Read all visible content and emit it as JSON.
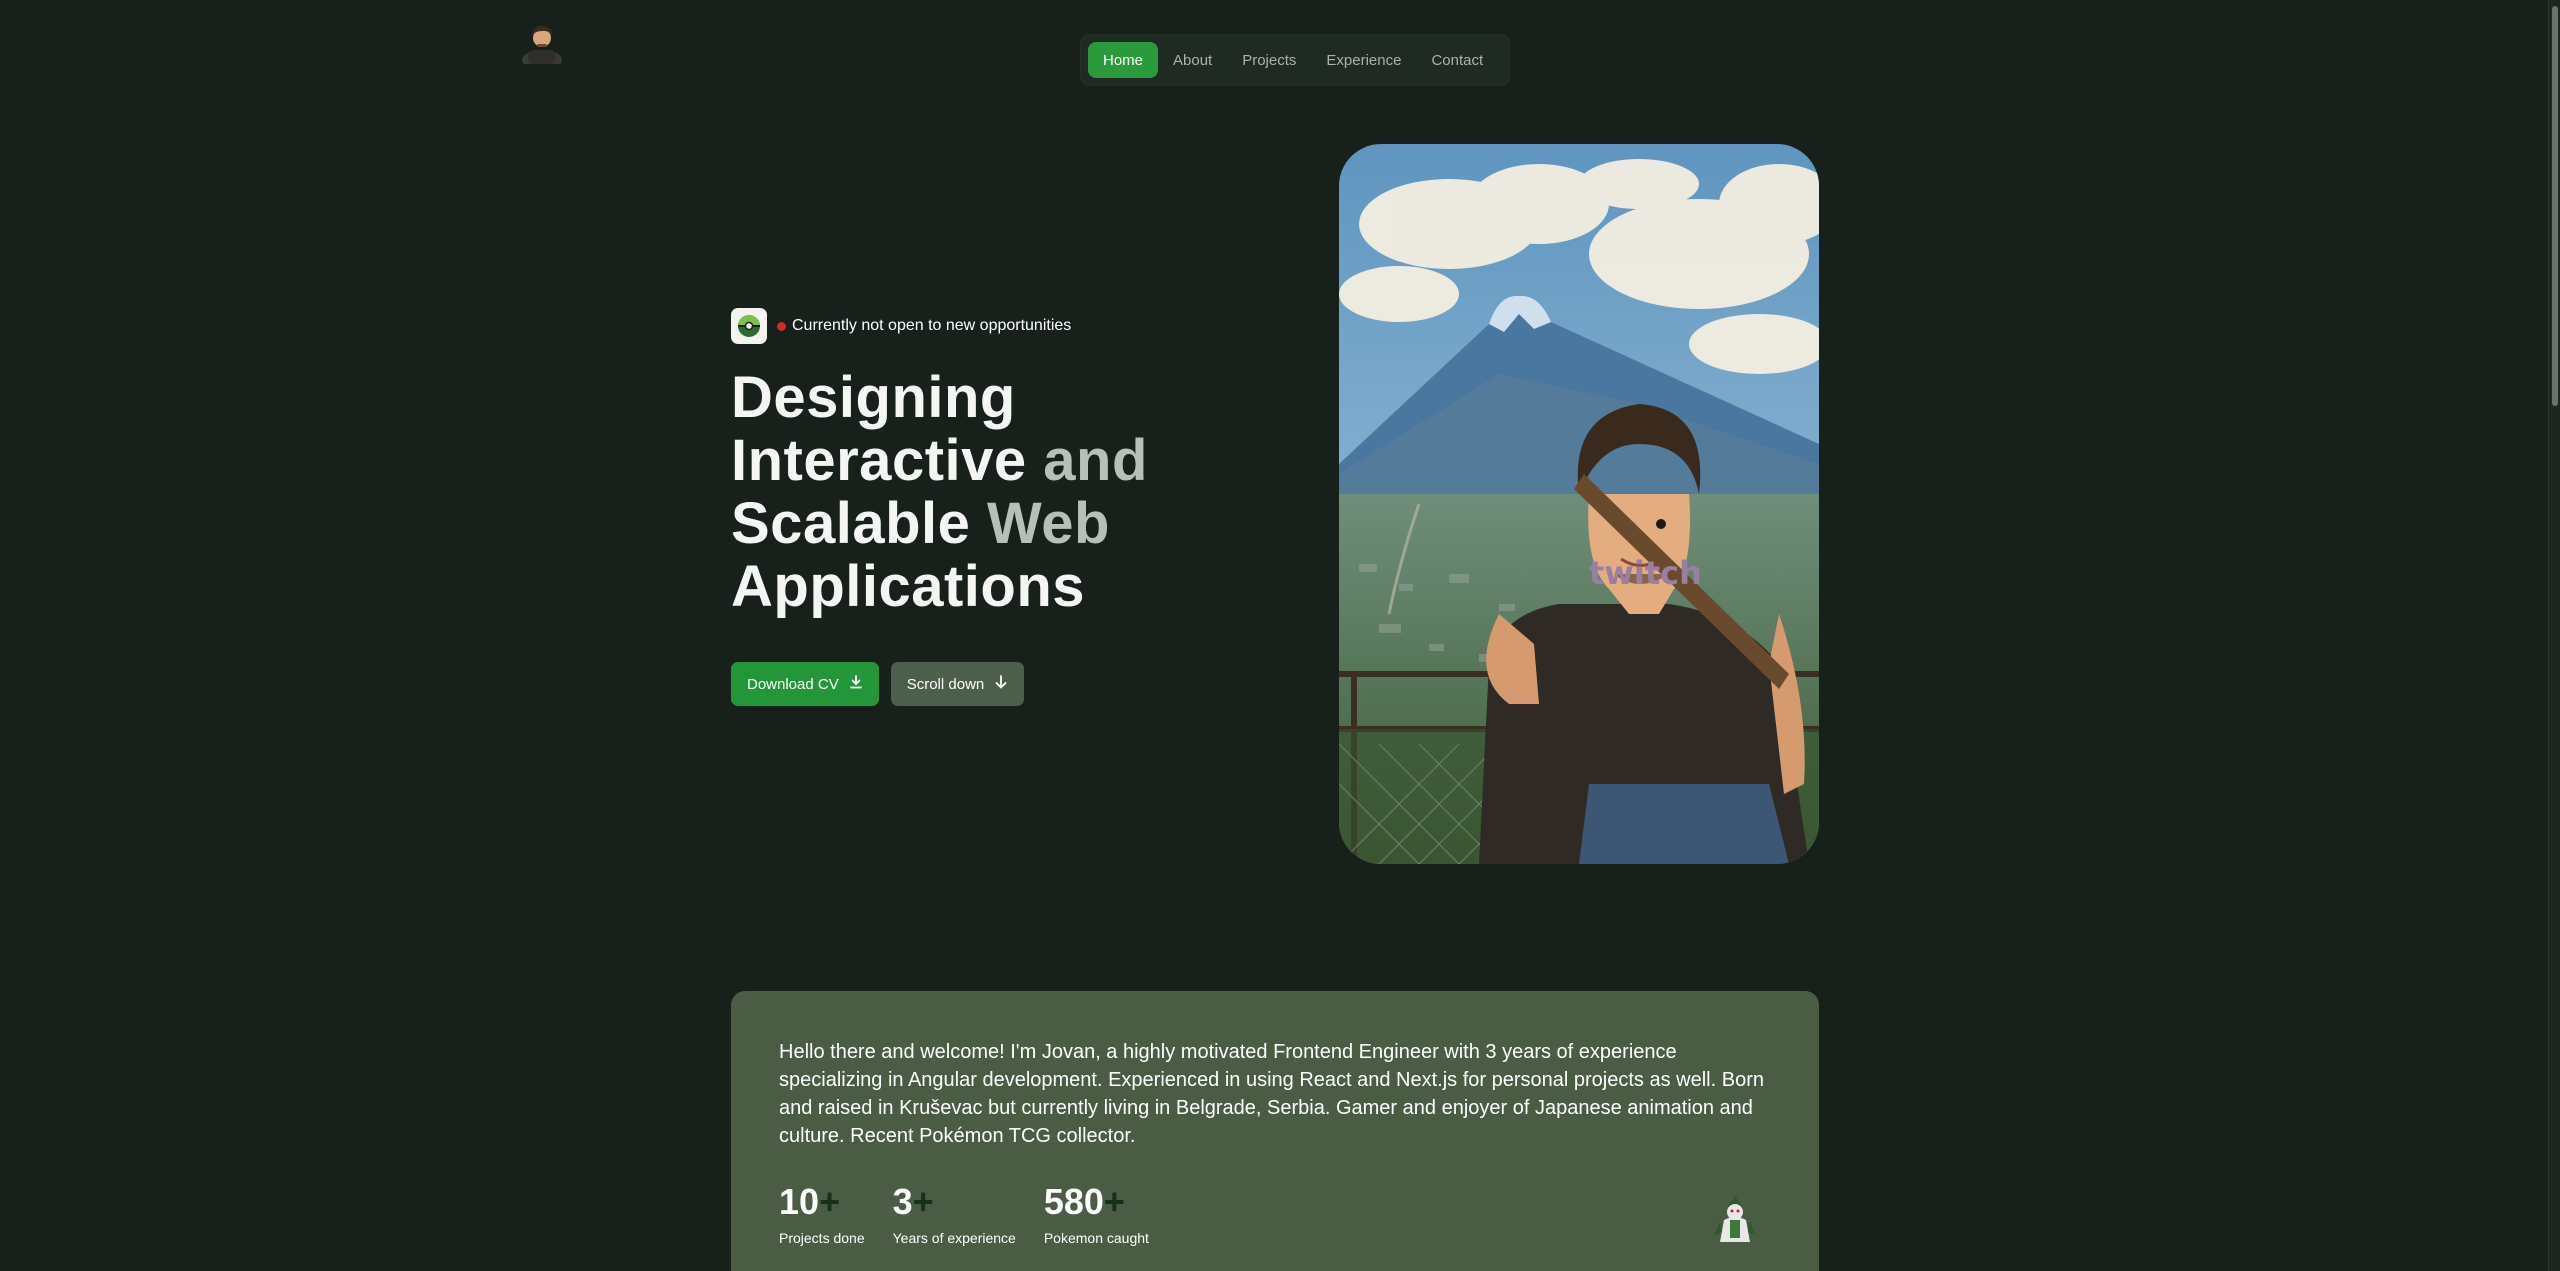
{
  "nav": {
    "items": [
      {
        "label": "Home",
        "active": true
      },
      {
        "label": "About",
        "active": false
      },
      {
        "label": "Projects",
        "active": false
      },
      {
        "label": "Experience",
        "active": false
      },
      {
        "label": "Contact",
        "active": false
      }
    ]
  },
  "hero": {
    "status": "Currently not open to new opportunities",
    "headline_word_1": "Designing",
    "headline_word_2": "Interactive",
    "headline_word_3": "and",
    "headline_word_4": "Scalable",
    "headline_word_5": "Web",
    "headline_word_6": "Applications",
    "download_label": "Download CV",
    "scroll_label": "Scroll down"
  },
  "about": {
    "text": "Hello there and welcome! I'm Jovan, a highly motivated Frontend Engineer with 3 years of experience specializing in Angular development. Experienced in using React and Next.js for personal projects as well. Born and raised in Kruševac but currently living in Belgrade, Serbia. Gamer and enjoyer of Japanese animation and culture. Recent Pokémon TCG collector.",
    "stats": [
      {
        "value": "10",
        "suffix": "+",
        "label": "Projects done"
      },
      {
        "value": "3",
        "suffix": "+",
        "label": "Years of experience"
      },
      {
        "value": "580",
        "suffix": "+",
        "label": "Pokemon caught"
      }
    ]
  },
  "colors": {
    "background": "#18201b",
    "accent": "#24963a",
    "card": "#4a5c44",
    "status_dot": "#d42a2a"
  },
  "icons": {
    "download": "download-icon",
    "scroll": "arrow-down-icon",
    "status": "pokeball-badge-icon"
  }
}
